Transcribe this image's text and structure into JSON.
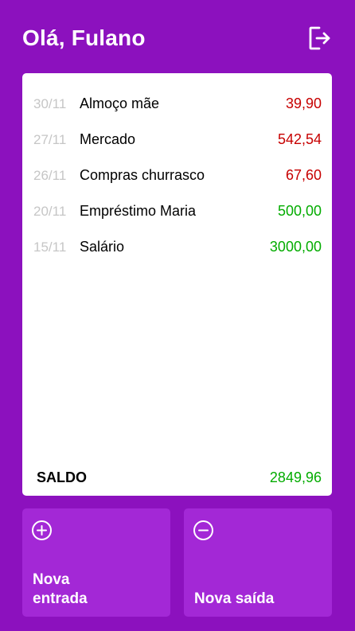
{
  "header": {
    "greeting": "Olá, Fulano",
    "logout_icon": "logout-icon"
  },
  "transactions": [
    {
      "date": "30/11",
      "description": "Almoço mãe",
      "value": "39,90",
      "type": "out"
    },
    {
      "date": "27/11",
      "description": "Mercado",
      "value": "542,54",
      "type": "out"
    },
    {
      "date": "26/11",
      "description": "Compras churrasco",
      "value": "67,60",
      "type": "out"
    },
    {
      "date": "20/11",
      "description": "Empréstimo Maria",
      "value": "500,00",
      "type": "in"
    },
    {
      "date": "15/11",
      "description": "Salário",
      "value": "3000,00",
      "type": "in"
    }
  ],
  "balance": {
    "label": "SALDO",
    "value": "2849,96"
  },
  "actions": {
    "new_entry": {
      "label": "Nova entrada",
      "icon": "plus-circle-icon"
    },
    "new_exit": {
      "label": "Nova saída",
      "icon": "minus-circle-icon"
    }
  },
  "colors": {
    "background": "#8C11BE",
    "button": "#A328D6",
    "income": "#03AC00",
    "expense": "#C70000",
    "date": "#C6C6C6"
  }
}
